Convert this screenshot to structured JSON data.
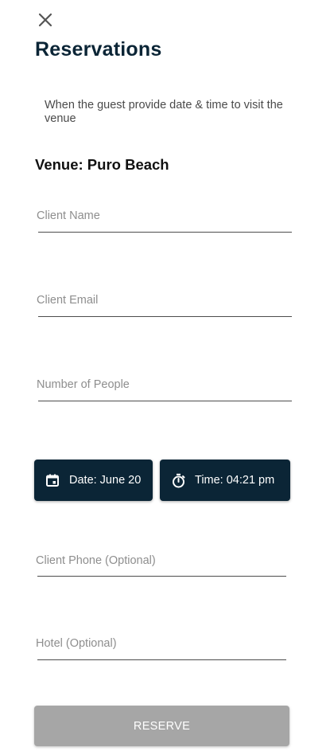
{
  "header": {
    "close_icon": "close-icon",
    "title": "Reservations"
  },
  "description": "When the guest provide date & time to visit the venue",
  "venue": {
    "label": "Venue: Puro Beach"
  },
  "form": {
    "client_name": {
      "placeholder": "Client Name",
      "value": ""
    },
    "client_email": {
      "placeholder": "Client Email",
      "value": ""
    },
    "number_of_people": {
      "placeholder": "Number of People",
      "value": ""
    },
    "date_button": {
      "label": "Date: June 20",
      "icon": "calendar-icon"
    },
    "time_button": {
      "label": "Time: 04:21 pm",
      "icon": "timer-icon"
    },
    "client_phone": {
      "placeholder": "Client Phone (Optional)",
      "value": ""
    },
    "hotel": {
      "placeholder": "Hotel (Optional)",
      "value": ""
    }
  },
  "reserve_button": {
    "label": "RESERVE",
    "state": "disabled"
  },
  "colors": {
    "primary": "#0b2536",
    "disabled": "#a6a6a6",
    "placeholder": "#8e8e8e"
  }
}
